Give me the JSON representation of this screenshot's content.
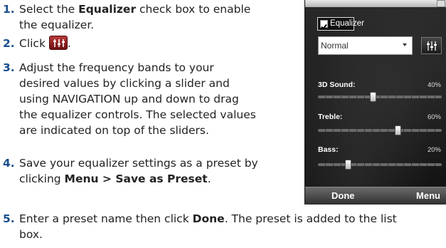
{
  "steps": [
    {
      "num": "1.",
      "line1_a": "Select the ",
      "line1_b": "Equalizer",
      "line1_c": " check box to enable",
      "line2": "the equalizer."
    },
    {
      "num": "2.",
      "text": "Click",
      "after": "."
    },
    {
      "num": "3.",
      "lines": [
        "Adjust the frequency bands to your",
        "desired values by clicking a slider and",
        "using NAVIGATION up and down to drag",
        "the equalizer controls. The selected values",
        "are indicated on top of the sliders."
      ]
    },
    {
      "num": "4.",
      "line1": "Save your equalizer settings as a preset by",
      "line2_a": "clicking ",
      "line2_b": "Menu > Save as Preset",
      "line2_c": "."
    },
    {
      "num": "5.",
      "line1_a": "Enter a preset name then click ",
      "line1_b": "Done",
      "line1_c": ". The preset is added to the list",
      "line2": "box."
    }
  ],
  "phone": {
    "equalizer_label": "Equalizer",
    "equalizer_checked": true,
    "preset_value": "Normal",
    "sliders": [
      {
        "label": "3D Sound:",
        "value_text": "40%",
        "value": 40
      },
      {
        "label": "Treble:",
        "value_text": "60%",
        "value": 60
      },
      {
        "label": "Bass:",
        "value_text": "20%",
        "value": 20
      }
    ],
    "softkey_left": "Done",
    "softkey_right": "Menu"
  }
}
